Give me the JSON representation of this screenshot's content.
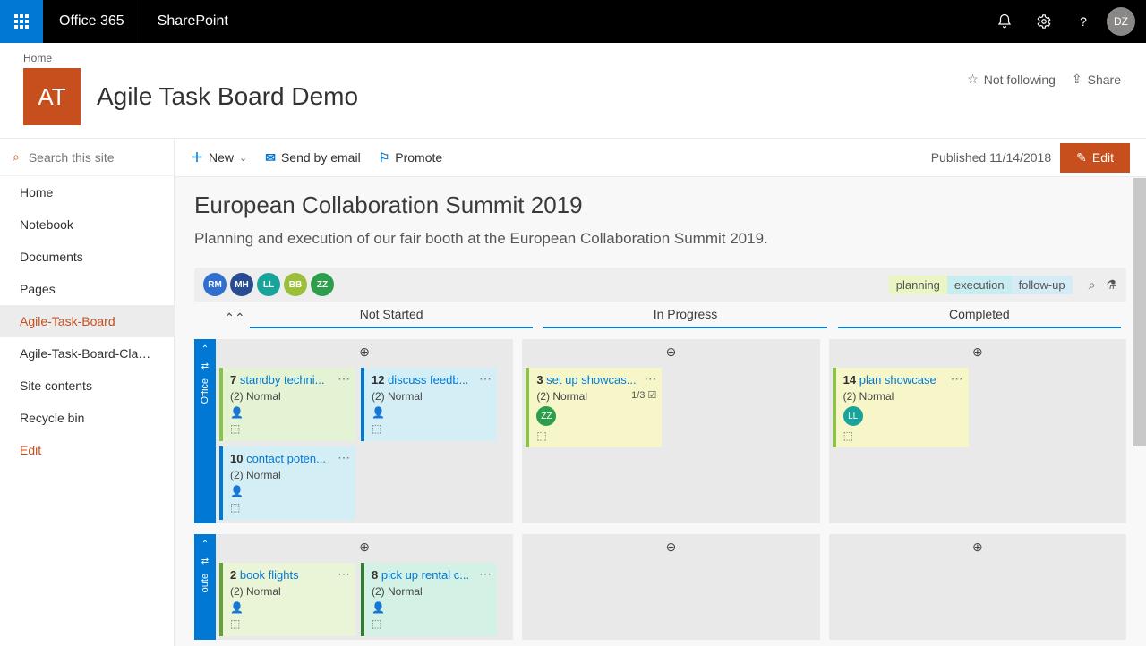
{
  "topbar": {
    "brand1": "Office 365",
    "brand2": "SharePoint",
    "user_initials": "DZ"
  },
  "breadcrumb": "Home",
  "site": {
    "tile": "AT",
    "title": "Agile Task Board Demo"
  },
  "header_actions": {
    "follow": "Not following",
    "share": "Share"
  },
  "cmdbar": {
    "new": "New",
    "email": "Send by email",
    "promote": "Promote",
    "published": "Published 11/14/2018",
    "edit": "Edit"
  },
  "search": {
    "placeholder": "Search this site"
  },
  "nav": [
    "Home",
    "Notebook",
    "Documents",
    "Pages",
    "Agile-Task-Board",
    "Agile-Task-Board-Clas...",
    "Site contents",
    "Recycle bin",
    "Edit"
  ],
  "nav_active_index": 4,
  "page": {
    "title": "European Collaboration Summit 2019",
    "desc": "Planning and execution of our fair booth at the European Collaboration Summit 2019."
  },
  "people": [
    {
      "initials": "RM",
      "color": "#2f6fd0"
    },
    {
      "initials": "MH",
      "color": "#274c91"
    },
    {
      "initials": "LL",
      "color": "#1aa39a"
    },
    {
      "initials": "BB",
      "color": "#9bbf3b"
    },
    {
      "initials": "ZZ",
      "color": "#2e9e4d"
    }
  ],
  "tags": [
    {
      "label": "planning",
      "bg": "#eaf5c4"
    },
    {
      "label": "execution",
      "bg": "#c8edf0"
    },
    {
      "label": "follow-up",
      "bg": "#d5ecf7"
    }
  ],
  "columns": [
    "Not Started",
    "In Progress",
    "Completed"
  ],
  "lanes": [
    {
      "name": "Office",
      "rows": [
        {
          "col": 0,
          "cards": [
            {
              "id": "7",
              "title": "standby techni...",
              "priority": "(2) Normal",
              "style": "green"
            },
            {
              "id": "12",
              "title": "discuss feedb...",
              "priority": "(2) Normal",
              "style": "blue"
            },
            {
              "id": "10",
              "title": "contact poten...",
              "priority": "(2) Normal",
              "style": "blue"
            }
          ]
        },
        {
          "col": 1,
          "cards": [
            {
              "id": "3",
              "title": "set up showcas...",
              "priority": "(2) Normal",
              "style": "yellow",
              "sub": "1/3",
              "avatar": {
                "t": "ZZ",
                "c": "#2e9e4d"
              }
            }
          ]
        },
        {
          "col": 2,
          "cards": [
            {
              "id": "14",
              "title": "plan showcase",
              "priority": "(2) Normal",
              "style": "yellow",
              "avatar": {
                "t": "LL",
                "c": "#1aa39a"
              }
            }
          ]
        }
      ]
    },
    {
      "name": "oute",
      "rows": [
        {
          "col": 0,
          "cards": [
            {
              "id": "2",
              "title": "book flights",
              "priority": "(2) Normal",
              "style": "lime"
            },
            {
              "id": "8",
              "title": "pick up rental c...",
              "priority": "(2) Normal",
              "style": "teal"
            }
          ]
        },
        {
          "col": 1,
          "cards": []
        },
        {
          "col": 2,
          "cards": []
        }
      ]
    }
  ]
}
